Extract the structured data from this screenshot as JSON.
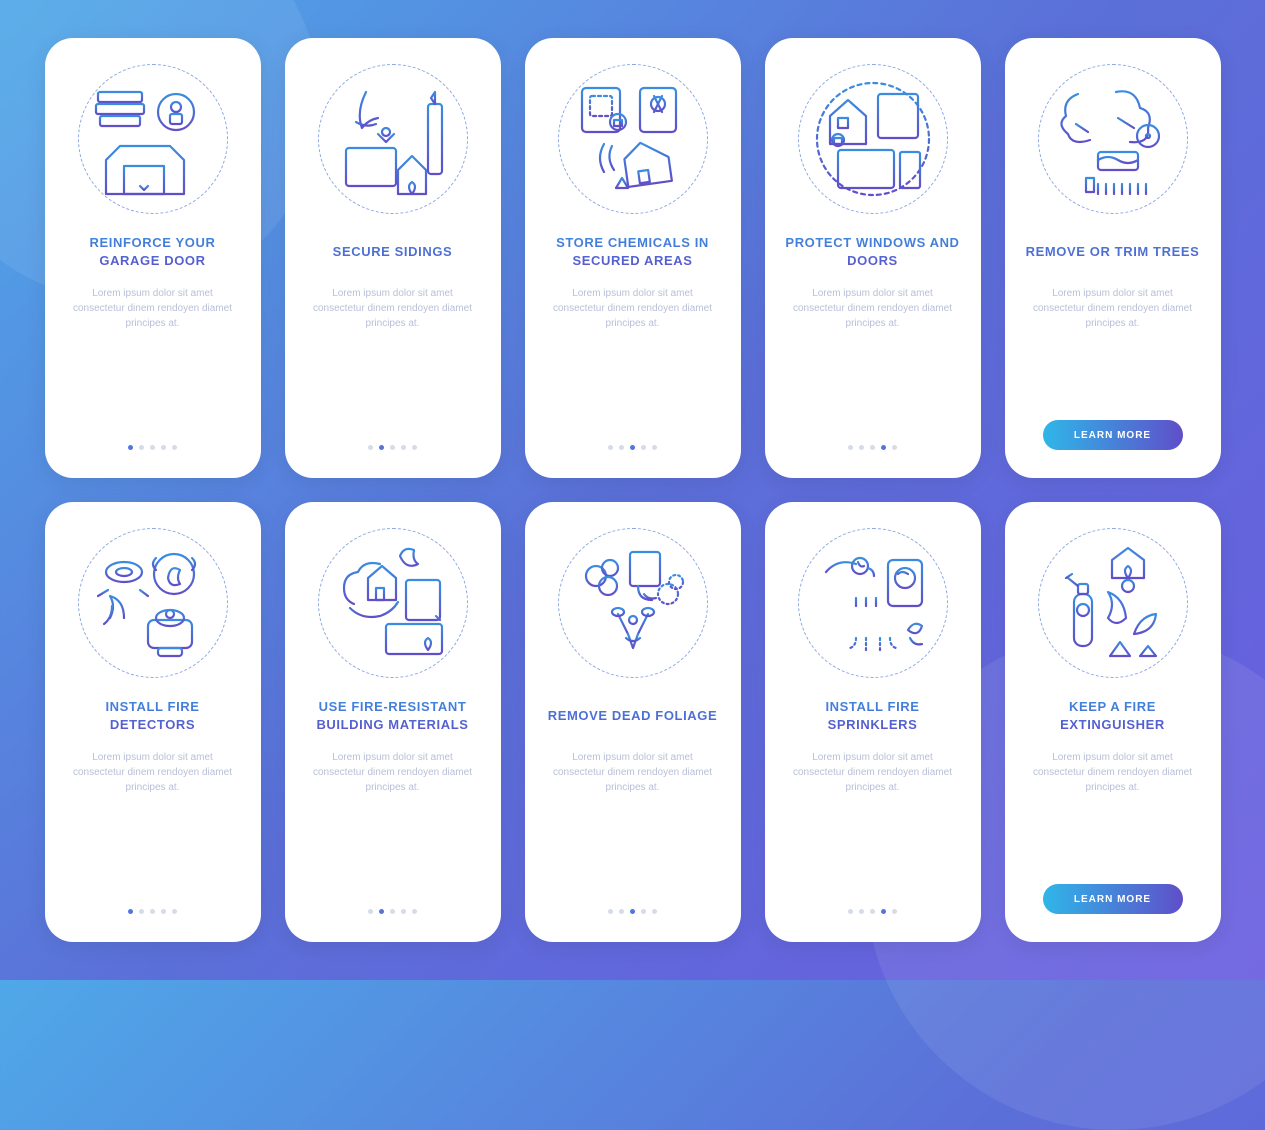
{
  "lorem": "Lorem ipsum dolor sit amet consectetur dinem rendoyen diamet principes at.",
  "cta_label": "LEARN MORE",
  "dots_total": 5,
  "screens": [
    {
      "id": "garage",
      "title": "REINFORCE YOUR GARAGE DOOR",
      "active_dot": 0,
      "has_cta": false,
      "icon": "garage-icon"
    },
    {
      "id": "sidings",
      "title": "SECURE SIDINGS",
      "active_dot": 1,
      "has_cta": false,
      "icon": "sidings-icon"
    },
    {
      "id": "chemicals",
      "title": "STORE CHEMICALS IN SECURED AREAS",
      "active_dot": 2,
      "has_cta": false,
      "icon": "chemicals-icon"
    },
    {
      "id": "windows",
      "title": "PROTECT WINDOWS AND DOORS",
      "active_dot": 3,
      "has_cta": false,
      "icon": "windows-icon"
    },
    {
      "id": "trees",
      "title": "REMOVE OR TRIM TREES",
      "active_dot": 4,
      "has_cta": true,
      "icon": "trees-icon"
    },
    {
      "id": "detectors",
      "title": "INSTALL FIRE DETECTORS",
      "active_dot": 0,
      "has_cta": false,
      "icon": "detectors-icon"
    },
    {
      "id": "materials",
      "title": "USE FIRE-RESISTANT BUILDING MATERIALS",
      "active_dot": 1,
      "has_cta": false,
      "icon": "materials-icon"
    },
    {
      "id": "foliage",
      "title": "REMOVE DEAD FOLIAGE",
      "active_dot": 2,
      "has_cta": false,
      "icon": "foliage-icon"
    },
    {
      "id": "sprinklers",
      "title": "INSTALL FIRE SPRINKLERS",
      "active_dot": 3,
      "has_cta": false,
      "icon": "sprinklers-icon"
    },
    {
      "id": "extinguisher",
      "title": "KEEP A FIRE EXTINGUISHER",
      "active_dot": 4,
      "has_cta": true,
      "icon": "extinguisher-icon"
    }
  ]
}
